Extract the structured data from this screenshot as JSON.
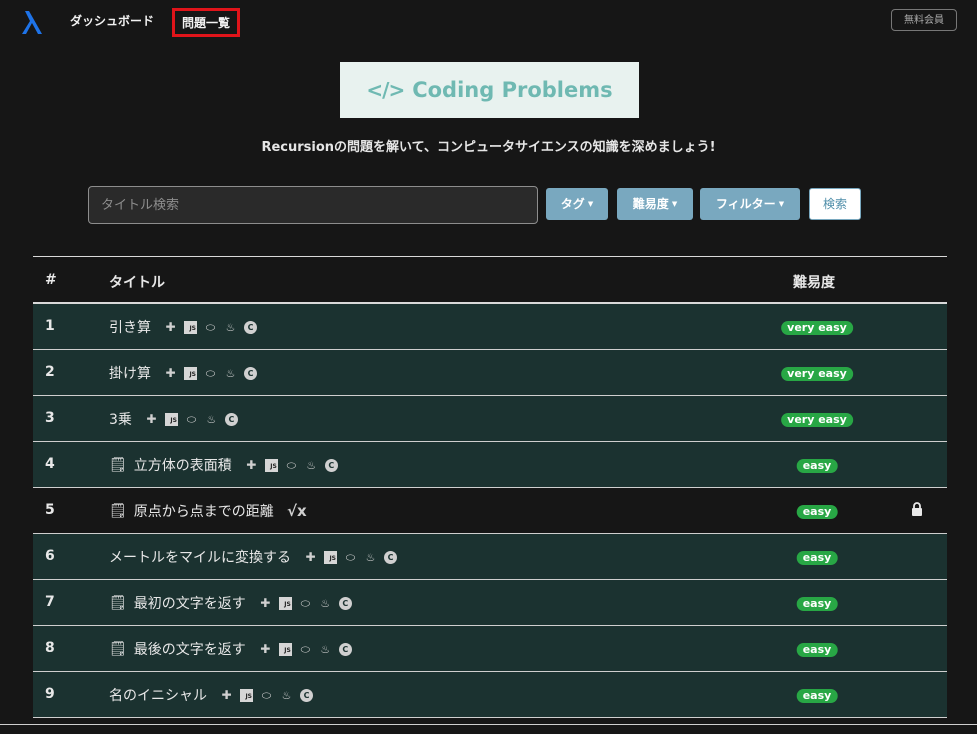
{
  "nav": {
    "links": [
      "ダッシュボード",
      "問題一覧"
    ],
    "member_label": "無料会員",
    "accent": "#1e73e8",
    "highlight_color": "#e0141a"
  },
  "banner": {
    "icon": "code-icon",
    "text": "Coding Problems",
    "bg": "#e8f2ef",
    "color": "#6fb9b2"
  },
  "subtitle": "Recursionの問題を解いて、コンピュータサイエンスの知識を深めましょう!",
  "search": {
    "placeholder": "タイトル検索",
    "value": "",
    "tag_label": "タグ",
    "difficulty_label": "難易度",
    "filter_label": "フィルター",
    "submit_label": "検索"
  },
  "table": {
    "headers": {
      "num": "#",
      "title": "タイトル",
      "difficulty": "難易度"
    },
    "rows": [
      {
        "num": "1",
        "title": "引き算",
        "memo": false,
        "icons": [
          "python-icon",
          "javascript-icon",
          "php-icon",
          "java-icon",
          "cpp-icon"
        ],
        "difficulty": "very easy",
        "locked": false
      },
      {
        "num": "2",
        "title": "掛け算",
        "memo": false,
        "icons": [
          "python-icon",
          "javascript-icon",
          "php-icon",
          "java-icon",
          "cpp-icon"
        ],
        "difficulty": "very easy",
        "locked": false
      },
      {
        "num": "3",
        "title": "3乗",
        "memo": false,
        "icons": [
          "python-icon",
          "javascript-icon",
          "php-icon",
          "java-icon",
          "cpp-icon"
        ],
        "difficulty": "very easy",
        "locked": false
      },
      {
        "num": "4",
        "title": "立方体の表面積",
        "memo": true,
        "icons": [
          "python-icon",
          "javascript-icon",
          "php-icon",
          "java-icon",
          "cpp-icon"
        ],
        "difficulty": "easy",
        "locked": false
      },
      {
        "num": "5",
        "title": "原点から点までの距離",
        "memo": true,
        "icons": [
          "sqrt-icon"
        ],
        "difficulty": "easy",
        "locked": true
      },
      {
        "num": "6",
        "title": "メートルをマイルに変換する",
        "memo": false,
        "icons": [
          "python-icon",
          "javascript-icon",
          "php-icon",
          "java-icon",
          "cpp-icon"
        ],
        "difficulty": "easy",
        "locked": false
      },
      {
        "num": "7",
        "title": "最初の文字を返す",
        "memo": true,
        "icons": [
          "python-icon",
          "javascript-icon",
          "php-icon",
          "java-icon",
          "cpp-icon"
        ],
        "difficulty": "easy",
        "locked": false
      },
      {
        "num": "8",
        "title": "最後の文字を返す",
        "memo": true,
        "icons": [
          "python-icon",
          "javascript-icon",
          "php-icon",
          "java-icon",
          "cpp-icon"
        ],
        "difficulty": "easy",
        "locked": false
      },
      {
        "num": "9",
        "title": "名のイニシャル",
        "memo": false,
        "icons": [
          "python-icon",
          "javascript-icon",
          "php-icon",
          "java-icon",
          "cpp-icon"
        ],
        "difficulty": "easy",
        "locked": false
      }
    ],
    "row_colors": {
      "dark_teal": "#1b3230",
      "dark": "#161616"
    },
    "badge_color": "#28a745"
  }
}
